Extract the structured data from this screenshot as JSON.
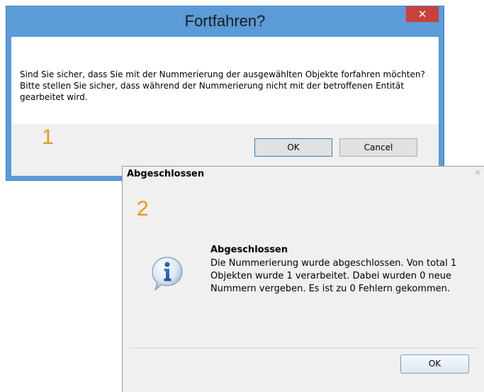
{
  "dialog1": {
    "title": "Fortfahren?",
    "close_glyph": "✕",
    "message": "Sind Sie sicher, dass Sie mit der Nummerierung der ausgewählten Objekte forfahren möchten? Bitte stellen Sie sicher, dass während der Nummerierung nicht mit der betroffenen Entität gearbeitet wird.",
    "step_number": "1",
    "ok_label": "OK",
    "cancel_label": "Cancel",
    "colors": {
      "frame": "#5a9bd8",
      "close": "#c9413a",
      "step": "#f2931d"
    }
  },
  "dialog2": {
    "title": "Abgeschlossen",
    "close_glyph": "✕",
    "step_number": "2",
    "icon": "info-icon",
    "heading": "Abgeschlossen",
    "message": "Die Nummerierung wurde abgeschlossen. Von total 1 Objekten wurde 1 verarbeitet. Dabei wurden 0 neue Nummern vergeben. Es ist zu 0 Fehlern gekommen.",
    "ok_label": "OK"
  }
}
